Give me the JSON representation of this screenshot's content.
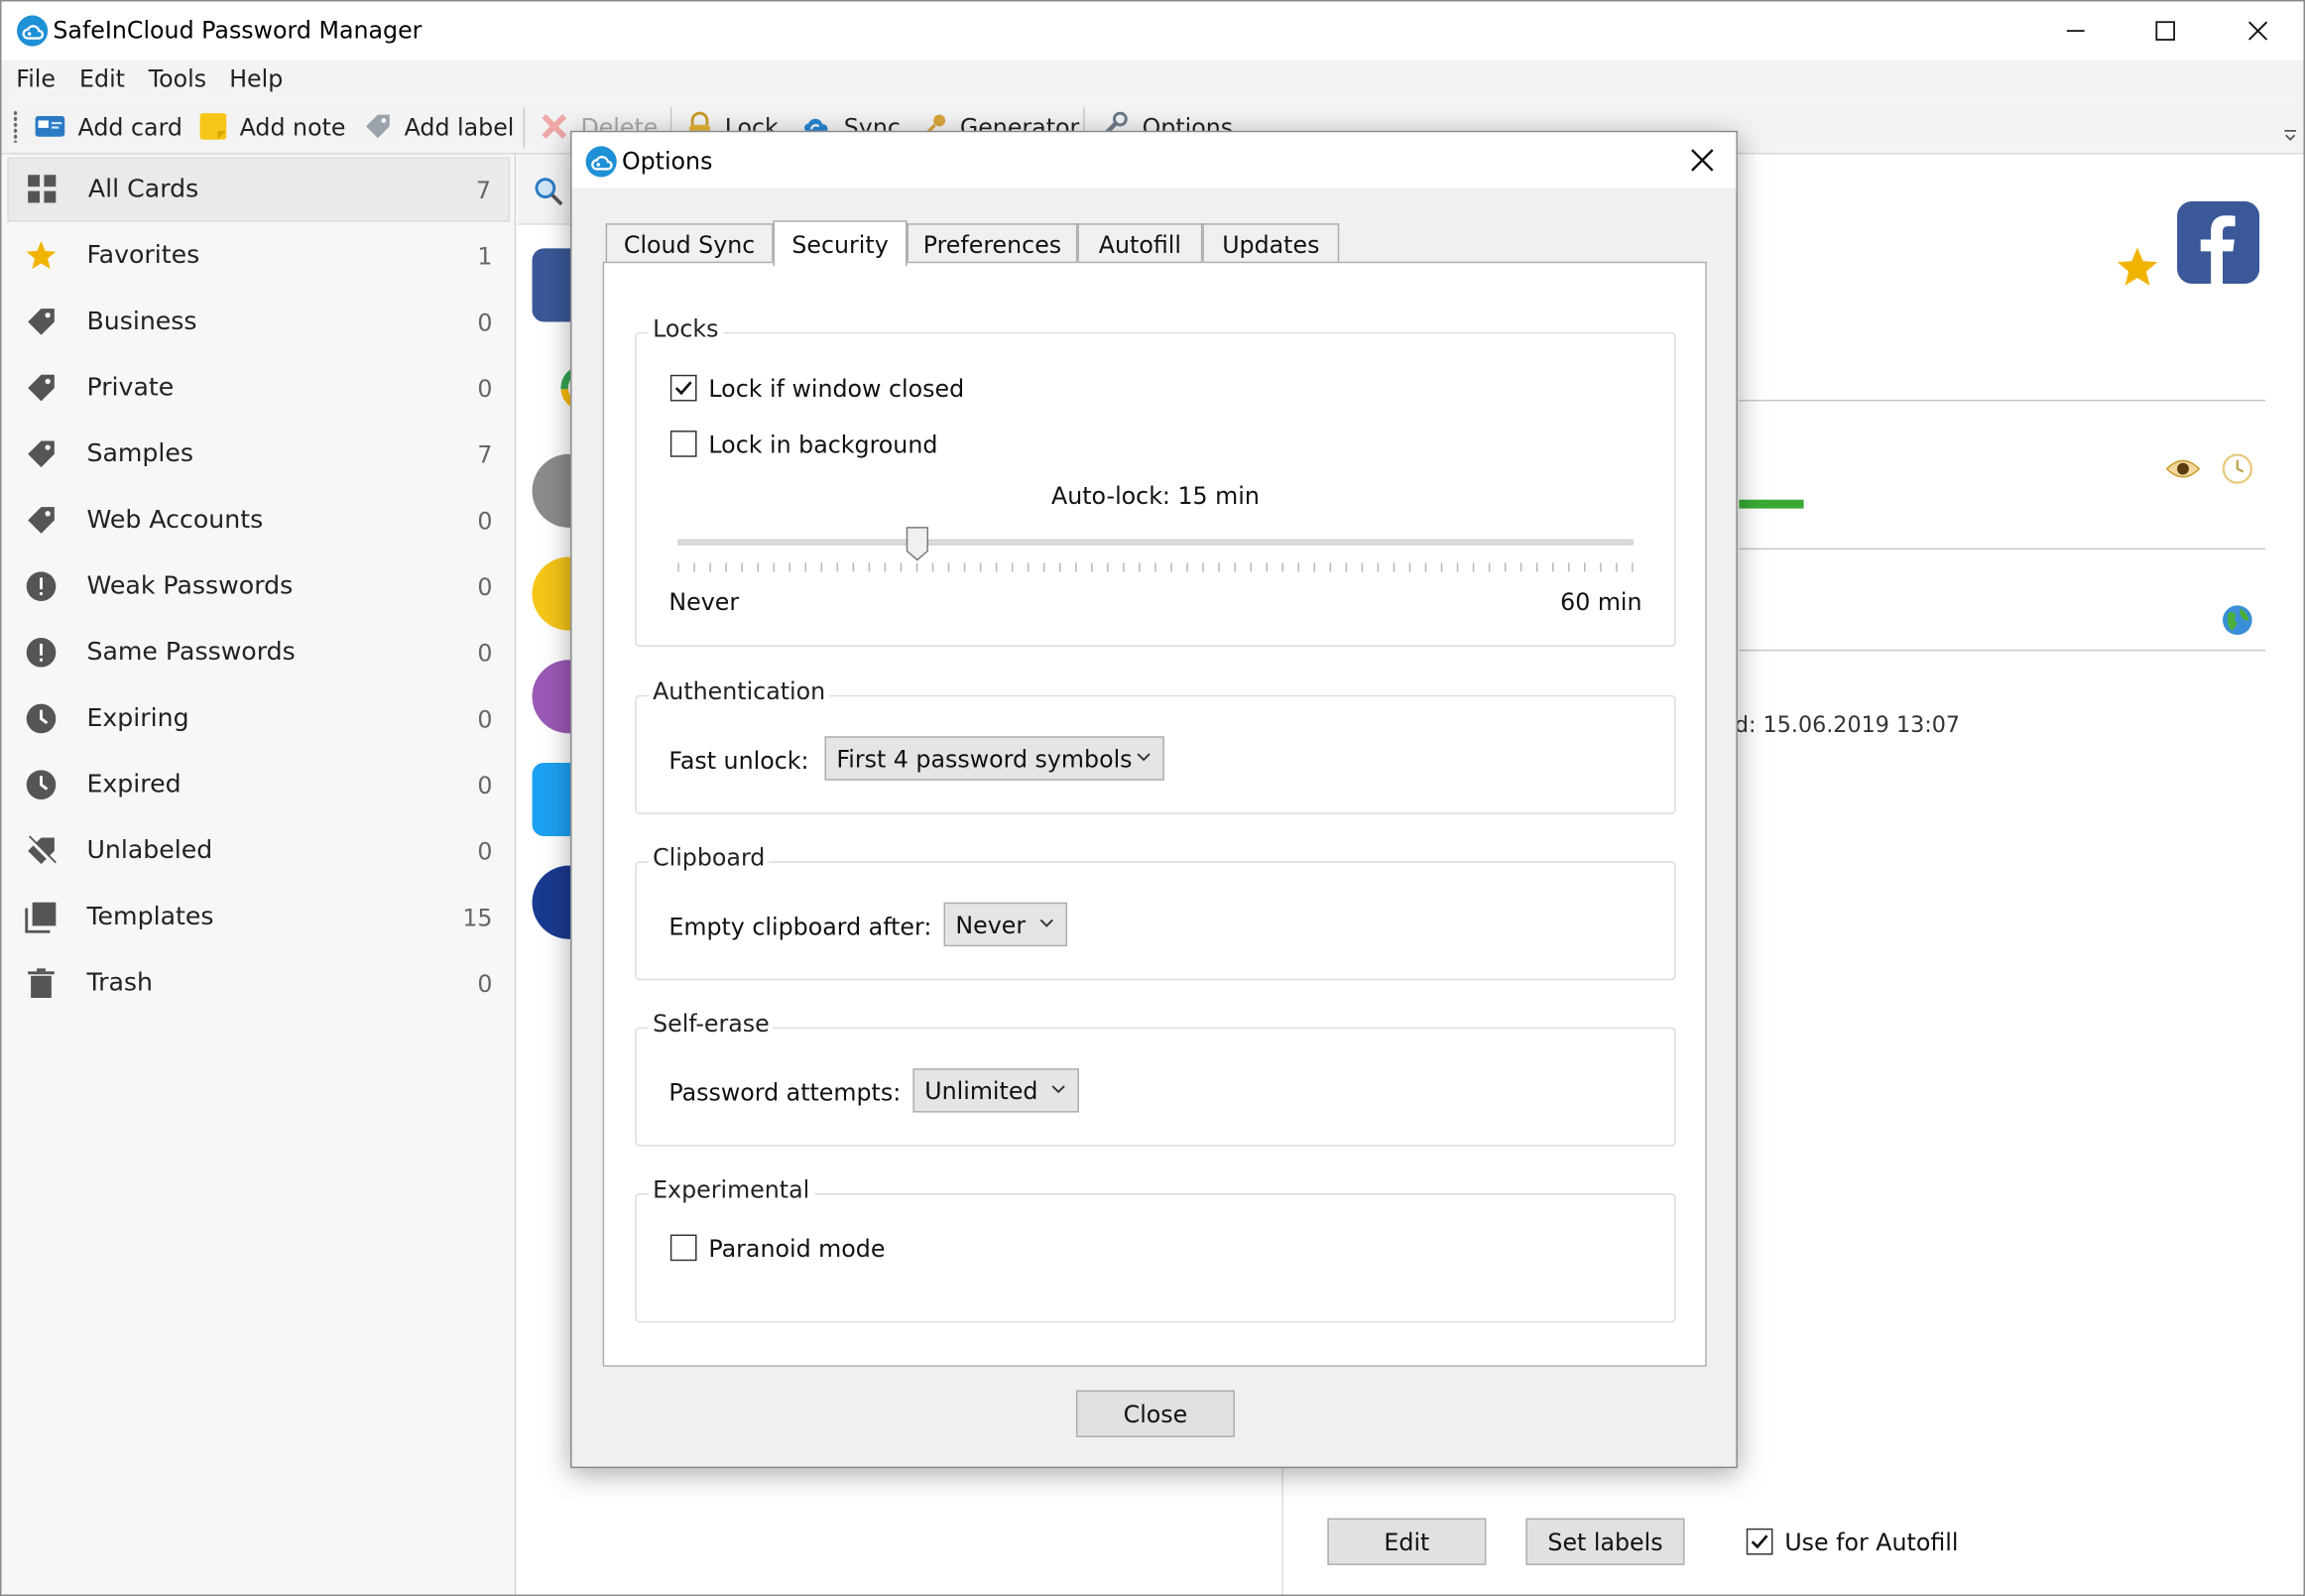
{
  "window": {
    "title": "SafeInCloud Password Manager"
  },
  "menu": {
    "items": [
      "File",
      "Edit",
      "Tools",
      "Help"
    ]
  },
  "toolbar": {
    "add_card": "Add card",
    "add_note": "Add note",
    "add_label": "Add label",
    "delete": "Delete",
    "lock": "Lock",
    "sync": "Sync",
    "generator": "Generator",
    "options": "Options"
  },
  "sidebar": {
    "items": [
      {
        "label": "All Cards",
        "count": "7",
        "icon": "grid-icon"
      },
      {
        "label": "Favorites",
        "count": "1",
        "icon": "star-icon"
      },
      {
        "label": "Business",
        "count": "0",
        "icon": "tag-icon"
      },
      {
        "label": "Private",
        "count": "0",
        "icon": "tag-icon"
      },
      {
        "label": "Samples",
        "count": "7",
        "icon": "tag-icon"
      },
      {
        "label": "Web Accounts",
        "count": "0",
        "icon": "tag-icon"
      },
      {
        "label": "Weak Passwords",
        "count": "0",
        "icon": "alert-icon"
      },
      {
        "label": "Same Passwords",
        "count": "0",
        "icon": "alert-icon"
      },
      {
        "label": "Expiring",
        "count": "0",
        "icon": "clock-icon"
      },
      {
        "label": "Expired",
        "count": "0",
        "icon": "clock-icon"
      },
      {
        "label": "Unlabeled",
        "count": "0",
        "icon": "untag-icon"
      },
      {
        "label": "Templates",
        "count": "15",
        "icon": "templates-icon"
      },
      {
        "label": "Trash",
        "count": "0",
        "icon": "trash-icon"
      }
    ]
  },
  "detail": {
    "modified_text": "d: 15.06.2019 13:07",
    "edit_button": "Edit",
    "set_labels_button": "Set labels",
    "use_for_autofill": "Use for Autofill",
    "use_for_autofill_checked": true
  },
  "dialog": {
    "title": "Options",
    "tabs": [
      "Cloud Sync",
      "Security",
      "Preferences",
      "Autofill",
      "Updates"
    ],
    "active_tab": "Security",
    "locks": {
      "title": "Locks",
      "lock_if_closed": "Lock if window closed",
      "lock_if_closed_checked": true,
      "lock_in_background": "Lock in background",
      "lock_in_background_checked": false,
      "autolock_label": "Auto-lock: 15 min",
      "slider_min": "Never",
      "slider_max": "60 min",
      "slider_fraction": 0.25
    },
    "authentication": {
      "title": "Authentication",
      "fast_unlock_label": "Fast unlock:",
      "fast_unlock_value": "First 4 password symbols"
    },
    "clipboard": {
      "title": "Clipboard",
      "empty_after_label": "Empty clipboard after:",
      "empty_after_value": "Never"
    },
    "self_erase": {
      "title": "Self-erase",
      "attempts_label": "Password attempts:",
      "attempts_value": "Unlimited"
    },
    "experimental": {
      "title": "Experimental",
      "paranoid_label": "Paranoid mode",
      "paranoid_checked": false
    },
    "close_button": "Close"
  },
  "colors": {
    "accent": "#1e90d6",
    "star": "#f0b400",
    "strength": "#3aaa35",
    "facebook": "#3b5998"
  }
}
